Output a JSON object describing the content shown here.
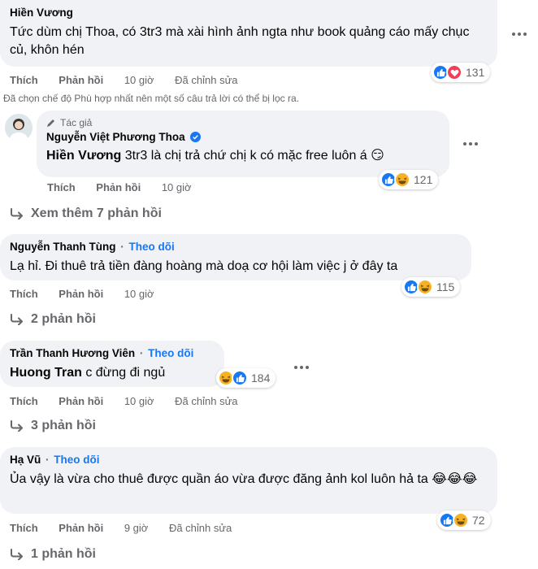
{
  "actions": {
    "like": "Thích",
    "reply": "Phản hồi",
    "edited": "Đã chỉnh sửa"
  },
  "filter_note": "Đã chọn chế độ Phù hợp nhất nên một số câu trả lời có thể bị lọc ra.",
  "author_badge": "Tác giả",
  "follow_label": "Theo dõi",
  "colors": {
    "blue": "#1877f2",
    "gray": "#65676b",
    "bubble": "#f0f2f5",
    "love": "#f33e58",
    "haha": "#f7b125"
  },
  "comments": [
    {
      "author": "Hiền Vương",
      "text": "Tức dùm chị Thoa, có 3tr3 mà xài hình ảnh ngta như book quảng cáo mấy chục củ, khôn hén",
      "time": "10 giờ",
      "reactions": [
        "like-icon",
        "love-icon"
      ],
      "count": "131"
    },
    {
      "author": "Nguyễn Việt Phương Thoa",
      "mention": "Hiền Vương",
      "text": " 3tr3 là chị trả chứ chị k có mặc free luôn á 😏",
      "time": "10 giờ",
      "reactions": [
        "like-icon",
        "haha-icon"
      ],
      "count": "121",
      "more_replies": "Xem thêm 7 phản hồi"
    },
    {
      "author": "Nguyễn Thanh Tùng",
      "text": "Lạ hỉ. Đi thuê trả tiền đàng hoàng mà doạ cơ hội làm việc j ở đây ta",
      "time": "10 giờ",
      "reactions": [
        "like-icon",
        "haha-icon"
      ],
      "count": "115",
      "replies": "2 phản hồi"
    },
    {
      "author": "Trần Thanh Hương Viên",
      "mention": "Huong Tran",
      "text": " c đừng đi ngủ",
      "time": "10 giờ",
      "reactions": [
        "haha-icon",
        "like-icon"
      ],
      "count": "184",
      "replies": "3 phản hồi"
    },
    {
      "author": "Hạ Vũ",
      "text": "Ủa vậy là vừa cho thuê được quần áo vừa được đăng ảnh kol luôn hả ta 😂😂😂",
      "time": "9 giờ",
      "reactions": [
        "like-icon",
        "haha-icon"
      ],
      "count": "72",
      "replies": "1 phản hồi"
    }
  ]
}
